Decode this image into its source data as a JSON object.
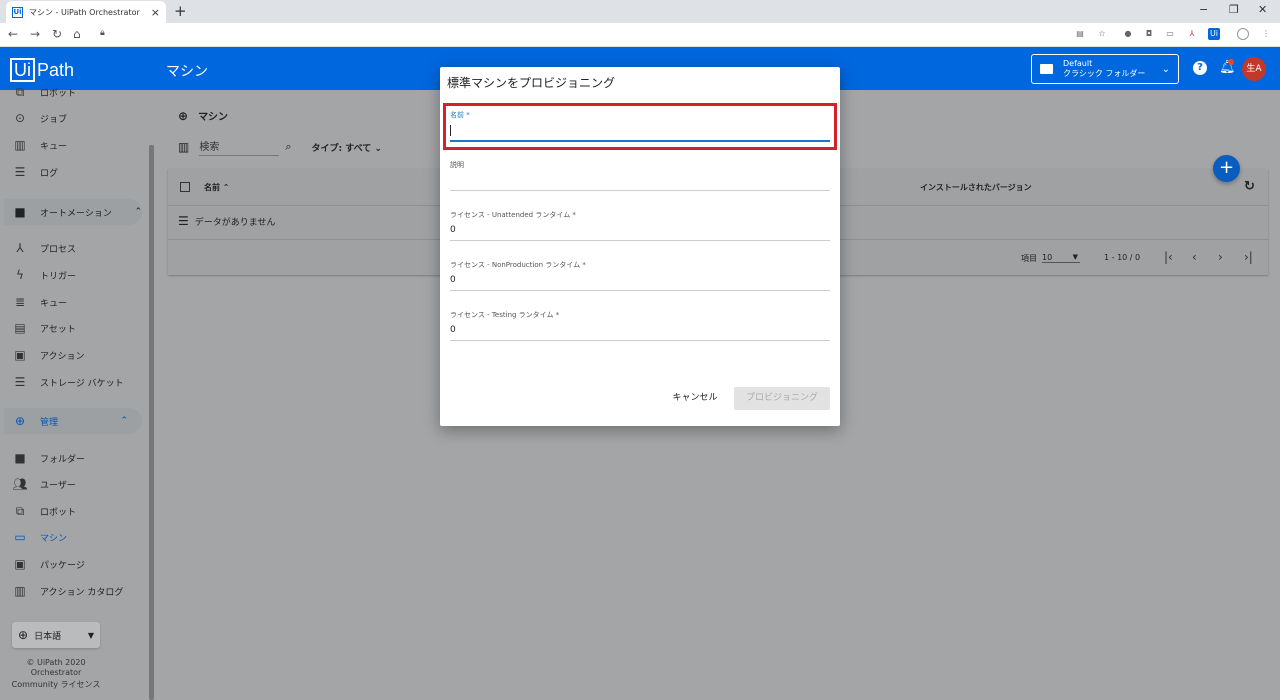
{
  "browser": {
    "tab_title": "マシン - UiPath Orchestrator",
    "new_tab": "+",
    "win_min": "−",
    "win_restore": "❐",
    "win_close": "✕"
  },
  "app": {
    "logo_ui": "Ui",
    "logo_path": "Path",
    "page_title": "マシン",
    "folder_line1": "Default",
    "folder_line2": "クラシック フォルダー",
    "avatar": "生A",
    "accent_color": "#0067df"
  },
  "sidebar": {
    "items_top": [
      {
        "icon": "robot-icon",
        "label": "ロボット"
      },
      {
        "icon": "play-icon",
        "label": "ジョブ"
      },
      {
        "icon": "chart-icon",
        "label": "キュー"
      },
      {
        "icon": "list-icon",
        "label": "ログ"
      }
    ],
    "automation_section": "オートメーション",
    "items_automation": [
      {
        "icon": "hierarchy-icon",
        "label": "プロセス"
      },
      {
        "icon": "bolt-icon",
        "label": "トリガー"
      },
      {
        "icon": "queue-icon",
        "label": "キュー"
      },
      {
        "icon": "asset-icon",
        "label": "アセット"
      },
      {
        "icon": "clipboard-icon",
        "label": "アクション"
      },
      {
        "icon": "storage-icon",
        "label": "ストレージ バケット"
      }
    ],
    "admin_section": "管理",
    "items_admin": [
      {
        "icon": "folder-icon",
        "label": "フォルダー"
      },
      {
        "icon": "users-icon",
        "label": "ユーザー"
      },
      {
        "icon": "robot-icon",
        "label": "ロボット"
      },
      {
        "icon": "monitor-icon",
        "label": "マシン"
      },
      {
        "icon": "package-icon",
        "label": "パッケージ"
      },
      {
        "icon": "catalog-icon",
        "label": "アクション カタログ"
      }
    ],
    "language": "日本語",
    "footer_line1": "© UiPath 2020",
    "footer_line2": "Orchestrator",
    "footer_line3": "Community ライセンス"
  },
  "main": {
    "title": "マシン",
    "search_placeholder": "検索",
    "type_filter": "タイプ: すべて",
    "col_name": "名前",
    "col_version": "インストールされたバージョン",
    "empty_text": "データがありません",
    "page_size_label": "項目",
    "page_size": "10",
    "range": "1 - 10 / 0"
  },
  "dialog": {
    "title": "標準マシンをプロビジョニング",
    "fields": [
      {
        "label": "名前 *",
        "value": ""
      },
      {
        "label": "説明",
        "value": ""
      },
      {
        "label": "ライセンス - Unattended ランタイム *",
        "value": "0"
      },
      {
        "label": "ライセンス - NonProduction ランタイム *",
        "value": "0"
      },
      {
        "label": "ライセンス - Testing ランタイム *",
        "value": "0"
      }
    ],
    "cancel": "キャンセル",
    "provision": "プロビジョニング",
    "highlight_color": "#d3222a"
  }
}
